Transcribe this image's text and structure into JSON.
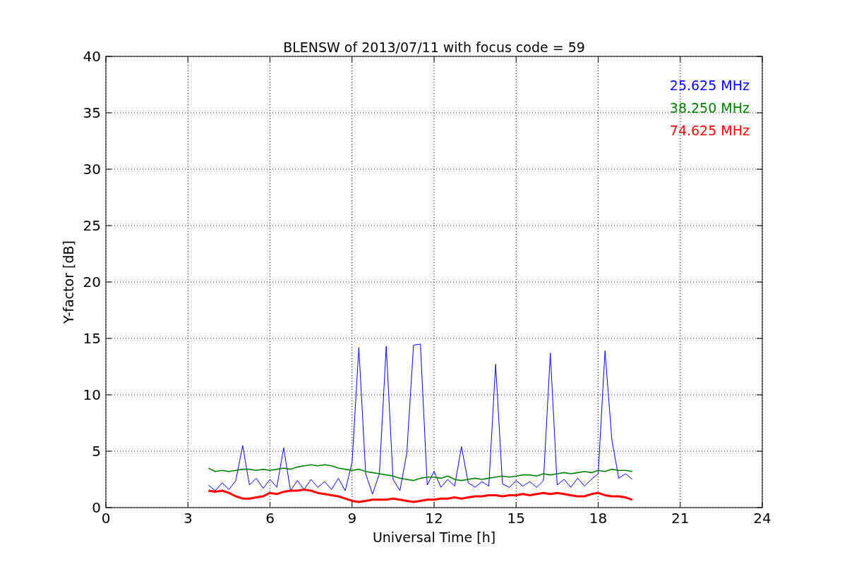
{
  "figure": {
    "chart_data": {
      "type": "line",
      "title": "BLENSW of 2013/07/11 with focus code = 59",
      "xlabel": "Universal Time [h]",
      "ylabel": "Y-factor [dB]",
      "xlim": [
        0,
        24
      ],
      "ylim": [
        0,
        40
      ],
      "xticks": [
        0,
        3,
        6,
        9,
        12,
        15,
        18,
        21,
        24
      ],
      "yticks": [
        0,
        5,
        10,
        15,
        20,
        25,
        30,
        35,
        40
      ],
      "grid": true,
      "x": [
        3.75,
        4,
        4.25,
        4.5,
        4.75,
        5,
        5.25,
        5.5,
        5.75,
        6,
        6.25,
        6.5,
        6.75,
        7,
        7.25,
        7.5,
        7.75,
        8,
        8.25,
        8.5,
        8.75,
        9,
        9.25,
        9.5,
        9.75,
        10,
        10.25,
        10.5,
        10.75,
        11,
        11.25,
        11.5,
        11.75,
        12,
        12.25,
        12.5,
        12.75,
        13,
        13.25,
        13.5,
        13.75,
        14,
        14.25,
        14.5,
        14.75,
        15,
        15.25,
        15.5,
        15.75,
        16,
        16.25,
        16.5,
        16.75,
        17,
        17.25,
        17.5,
        17.75,
        18,
        18.25,
        18.5,
        18.75,
        19,
        19.25
      ],
      "series": [
        {
          "name": "25.625 MHz",
          "color": "#0000ff",
          "values": [
            2.0,
            1.5,
            2.2,
            1.6,
            2.4,
            5.5,
            2.0,
            2.6,
            1.7,
            2.5,
            1.8,
            5.3,
            1.5,
            2.4,
            1.6,
            2.5,
            1.8,
            2.3,
            1.6,
            2.6,
            1.5,
            4.0,
            14.2,
            3.0,
            1.2,
            3.0,
            14.3,
            2.5,
            1.5,
            4.8,
            14.4,
            14.5,
            2.0,
            3.2,
            1.8,
            2.5,
            1.9,
            5.4,
            2.2,
            1.8,
            2.3,
            1.9,
            12.7,
            2.1,
            1.8,
            2.4,
            1.9,
            2.3,
            1.8,
            2.4,
            13.7,
            2.0,
            2.5,
            1.8,
            2.6,
            1.9,
            2.5,
            3.0,
            13.9,
            6.0,
            2.6,
            3.0,
            2.5
          ]
        },
        {
          "name": "38.250 MHz",
          "color": "#008000",
          "values": [
            3.5,
            3.2,
            3.3,
            3.2,
            3.3,
            3.4,
            3.4,
            3.3,
            3.4,
            3.3,
            3.4,
            3.5,
            3.4,
            3.6,
            3.7,
            3.8,
            3.7,
            3.8,
            3.7,
            3.5,
            3.4,
            3.3,
            3.4,
            3.2,
            3.1,
            3.0,
            2.9,
            2.8,
            2.6,
            2.5,
            2.4,
            2.6,
            2.7,
            2.7,
            2.6,
            2.8,
            2.5,
            2.4,
            2.5,
            2.6,
            2.5,
            2.6,
            2.7,
            2.8,
            2.7,
            2.8,
            2.9,
            2.9,
            2.8,
            3.0,
            2.9,
            3.0,
            3.1,
            3.0,
            3.1,
            3.2,
            3.1,
            3.3,
            3.2,
            3.4,
            3.3,
            3.3,
            3.2
          ]
        },
        {
          "name": "74.625 MHz",
          "color": "#ff0000",
          "values": [
            1.5,
            1.4,
            1.5,
            1.3,
            1.0,
            0.8,
            0.8,
            0.9,
            1.0,
            1.3,
            1.2,
            1.4,
            1.5,
            1.5,
            1.6,
            1.5,
            1.3,
            1.2,
            1.1,
            1.0,
            0.8,
            0.6,
            0.5,
            0.6,
            0.7,
            0.7,
            0.7,
            0.8,
            0.7,
            0.6,
            0.5,
            0.6,
            0.7,
            0.7,
            0.8,
            0.8,
            0.9,
            0.8,
            0.9,
            1.0,
            1.0,
            1.1,
            1.1,
            1.0,
            1.1,
            1.1,
            1.2,
            1.1,
            1.2,
            1.3,
            1.2,
            1.3,
            1.2,
            1.1,
            1.0,
            1.0,
            1.2,
            1.3,
            1.1,
            1.0,
            1.0,
            0.9,
            0.7
          ]
        }
      ]
    }
  }
}
